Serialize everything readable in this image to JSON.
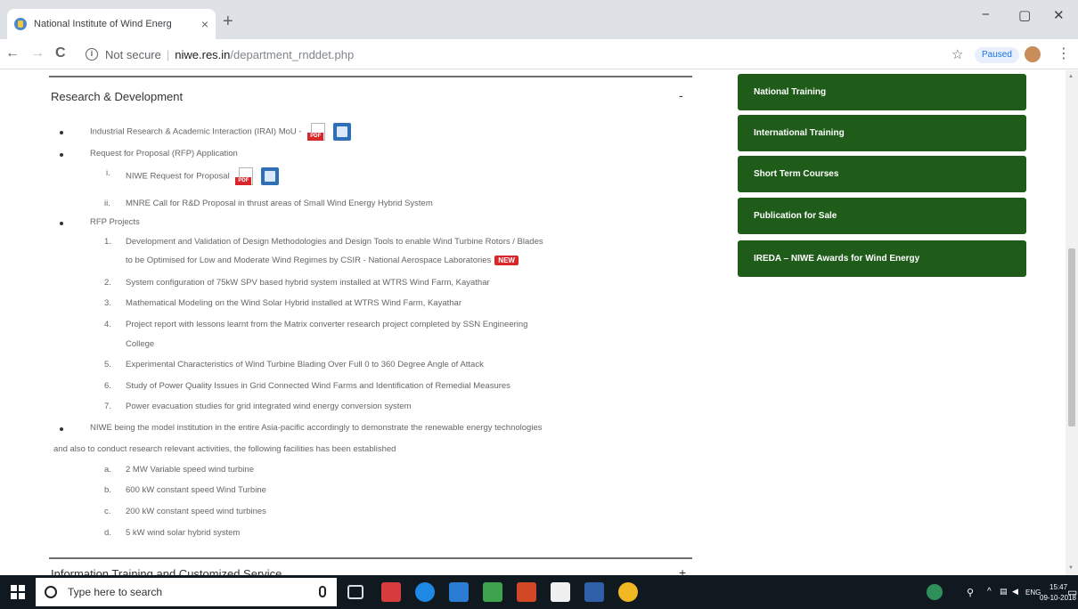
{
  "browser": {
    "tab_title": "National Institute of Wind Energ",
    "tab_close": "×",
    "new_tab": "+",
    "minimize": "−",
    "maximize": "▢",
    "close": "✕",
    "back": "←",
    "forward": "→",
    "reload": "C",
    "security": "Not secure",
    "url_host": "niwe.res.in",
    "url_path": "/department_rnddet.php",
    "paused_label": "Paused",
    "star": "☆",
    "menu": "⋮"
  },
  "section": {
    "title": "Research & Development",
    "toggle": "-",
    "next_title": "Information Training and Customized Service",
    "next_toggle": "+"
  },
  "items": {
    "iraim": "Industrial Research & Academic Interaction (IRAI) MoU -",
    "rfp_app": "Request for Proposal (RFP) Application",
    "rfp_sub": [
      {
        "num": "i.",
        "text": "NIWE Request for Proposal"
      },
      {
        "num": "ii.",
        "text": "MNRE Call for R&D Proposal in thrust areas of Small Wind Energy Hybrid System"
      }
    ],
    "rfp_projects": "RFP Projects",
    "projects": [
      {
        "num": "1.",
        "line1": "Development and Validation of Design Methodologies and Design Tools to enable Wind Turbine Rotors / Blades",
        "line2": "to be Optimised for Low and Moderate Wind Regimes by CSIR - National Aerospace Laboratories",
        "badge": "NEW"
      },
      {
        "num": "2.",
        "line1": "System configuration of 75kW SPV based hybrid system installed at WTRS Wind Farm, Kayathar"
      },
      {
        "num": "3.",
        "line1": "Mathematical Modeling on the Wind Solar Hybrid installed at WTRS Wind Farm, Kayathar"
      },
      {
        "num": "4.",
        "line1": "Project report with lessons learnt from the Matrix converter research project completed by SSN Engineering",
        "line2": "College"
      },
      {
        "num": "5.",
        "line1": "Experimental Characteristics of Wind Turbine Blading Over Full 0 to 360 Degree Angle of Attack"
      },
      {
        "num": "6.",
        "line1": "Study of Power Quality Issues in Grid Connected Wind Farms and Identification of Remedial Measures"
      },
      {
        "num": "7.",
        "line1": "Power evacuation studies for grid integrated wind energy conversion system"
      }
    ],
    "niwe_para1": "NIWE being the model institution in the entire Asia-pacific accordingly to demonstrate the renewable energy technologies",
    "niwe_para2": "and also to conduct research relevant activities, the following facilities has been established",
    "facilities": [
      {
        "num": "a.",
        "text": "2 MW Variable speed wind turbine"
      },
      {
        "num": "b.",
        "text": "600 kW constant speed Wind Turbine"
      },
      {
        "num": "c.",
        "text": "200 kW constant speed wind turbines"
      },
      {
        "num": "d.",
        "text": "5 kW wind solar hybrid system"
      }
    ]
  },
  "sidebar": {
    "buttons": [
      "National Training",
      "International Training",
      "Short Term Courses",
      "Publication for Sale",
      "IREDA – NIWE Awards for Wind Energy"
    ]
  },
  "taskbar": {
    "search_placeholder": "Type here to search",
    "lang": "ENG",
    "time": "15:47",
    "date": "09-10-2018"
  },
  "colors": {
    "sidebar_green": "#1f5c1a",
    "badge_red": "#d9262b"
  }
}
